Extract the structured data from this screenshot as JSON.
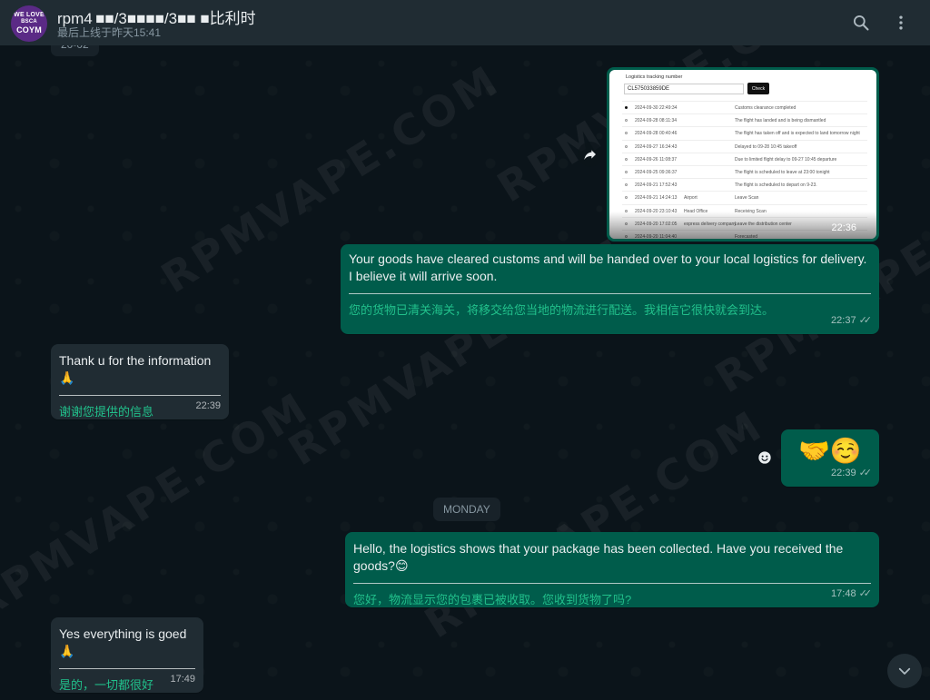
{
  "header": {
    "avatar_line1": "WE LOVE",
    "avatar_line2": "BSCA",
    "avatar_line3": "COYM",
    "title": "rpm4 ■■/3■■■■/3■■ ■比利时",
    "last_seen": "最后上线于昨天15:41",
    "search_icon": "search-icon",
    "menu_icon": "more-vertical-icon"
  },
  "watermark": "RPMVAPE.COM",
  "date_top_partial": "20-02",
  "image_message": {
    "tracking_label": "Logistics tracking number",
    "tracking_number": "CL575033859DE",
    "check_label": "Check",
    "time": "22:36",
    "rows": [
      {
        "ts": "2024-09-30 22:49:34",
        "loc": "",
        "ev": "Customs clearance completed",
        "filled": true
      },
      {
        "ts": "2024-09-28 08:11:34",
        "loc": "",
        "ev": "The flight has landed and is being dismantled",
        "filled": false
      },
      {
        "ts": "2024-09-28 00:40:46",
        "loc": "",
        "ev": "The flight has taken off and is expected to land tomorrow night",
        "filled": false
      },
      {
        "ts": "2024-09-27 16:34:43",
        "loc": "",
        "ev": "Delayed to 09-28 10:45 takeoff",
        "filled": false
      },
      {
        "ts": "2024-09-26 11:08:37",
        "loc": "",
        "ev": "Due to limited flight delay to 09-27 10:45 departure",
        "filled": false
      },
      {
        "ts": "2024-09-25 09:36:37",
        "loc": "",
        "ev": "The flight is scheduled to leave at 23:00 tonight",
        "filled": false
      },
      {
        "ts": "2024-09-21 17:52:43",
        "loc": "",
        "ev": "The flight is scheduled to depart on 9-23.",
        "filled": false
      },
      {
        "ts": "2024-09-21 14:24:13",
        "loc": "Airport",
        "ev": "Leave Scan",
        "filled": false
      },
      {
        "ts": "2024-09-20 23:10:43",
        "loc": "Head Office",
        "ev": "Receiving Scan",
        "filled": false
      },
      {
        "ts": "2024-09-20 17:02:05",
        "loc": "express delivery company",
        "ev": "Leave the distribution center",
        "filled": false
      },
      {
        "ts": "2024-09-20 11:04:40",
        "loc": "",
        "ev": "Forecasted",
        "filled": false
      }
    ]
  },
  "messages": [
    {
      "text": "Your goods have cleared customs and will be handed over to your local logistics for delivery. I believe it will arrive soon.",
      "translation": "您的货物已清关海关，将移交给您当地的物流进行配送。我相信它很快就会到达。",
      "time": "22:37"
    },
    {
      "text": "Thank u for the information",
      "emoji": "🙏",
      "translation": "谢谢您提供的信息",
      "time": "22:39"
    },
    {
      "emoji_text": "🤝☺️",
      "time": "22:39"
    },
    {
      "text": "Hello, the logistics shows that your package has been collected. Have you received the goods?",
      "emoji": "😊",
      "translation": "您好，物流显示您的包裹已被收取。您收到货物了吗?",
      "time": "17:48"
    },
    {
      "text": "Yes everything is goed",
      "emoji": "🙏",
      "translation": "是的，一切都很好",
      "time": "17:49"
    }
  ],
  "date_chip": "MONDAY",
  "colors": {
    "outgoing_bubble": "#005c4b",
    "incoming_bubble": "#202c33",
    "background": "#0b141a",
    "header": "#202c33",
    "translation": "#21c08b"
  }
}
